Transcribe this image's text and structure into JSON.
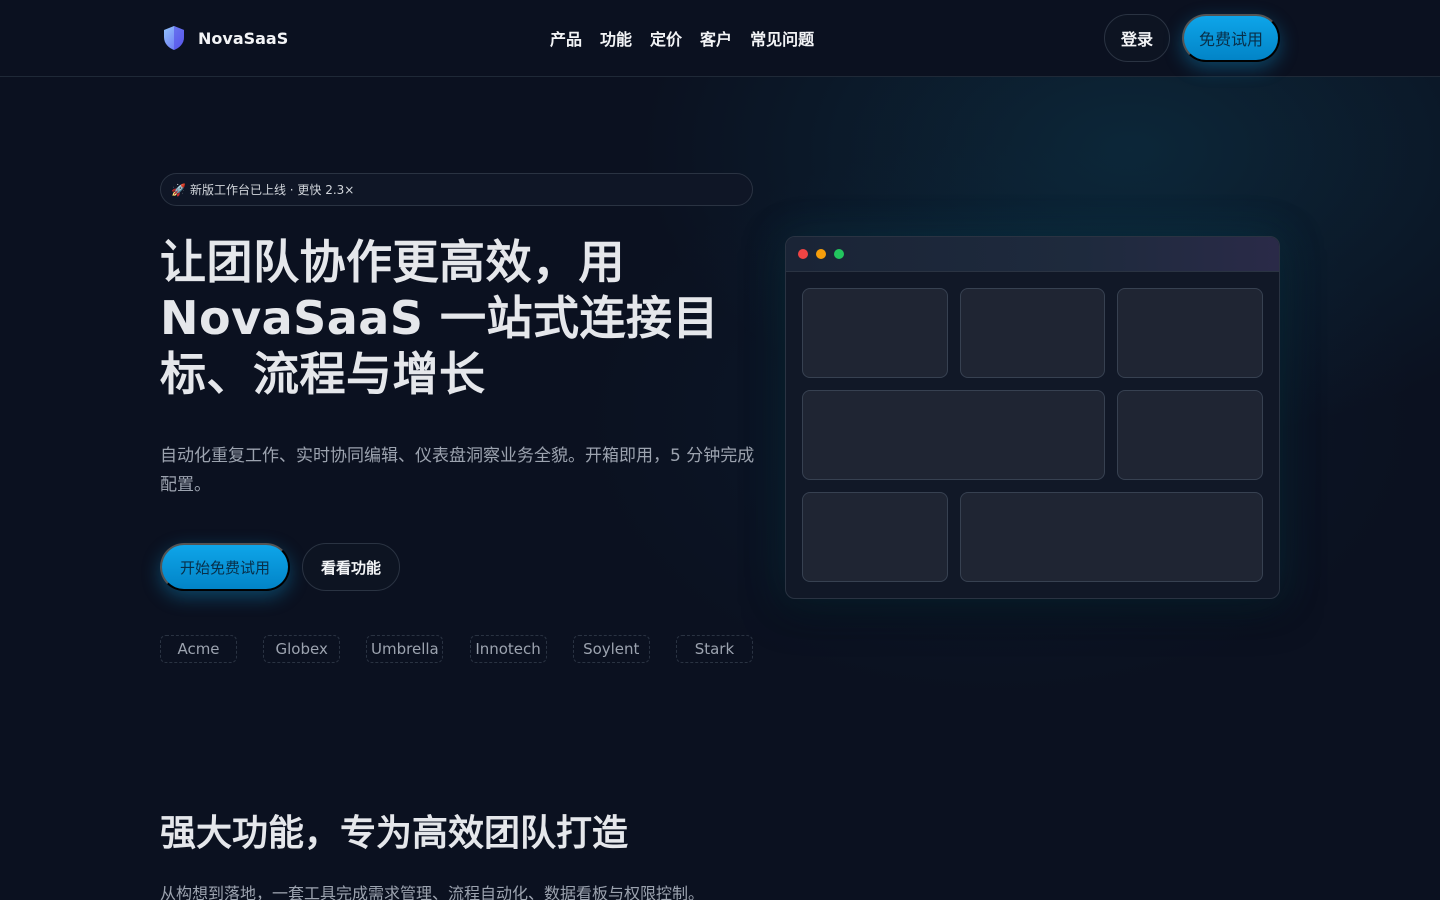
{
  "nav": {
    "brand": "NovaSaaS",
    "links": [
      "产品",
      "功能",
      "定价",
      "客户",
      "常见问题"
    ],
    "login": "登录",
    "trial": "免费试用"
  },
  "hero": {
    "badge_icon": "rocket-icon",
    "badge_emoji": "🚀",
    "badge": "新版工作台已上线 · 更快 2.3×",
    "title": "让团队协作更高效，用 NovaSaaS 一站式连接目标、流程与增长",
    "subtitle": "自动化重复工作、实时协同编辑、仪表盘洞察业务全貌。开箱即用，5 分钟完成配置。",
    "cta_primary": "开始免费试用",
    "cta_secondary": "看看功能",
    "logos": [
      "Acme",
      "Globex",
      "Umbrella",
      "Innotech",
      "Soylent",
      "Stark"
    ]
  },
  "features": {
    "title": "强大功能，专为高效团队打造",
    "subtitle": "从构想到落地，一套工具完成需求管理、流程自动化、数据看板与权限控制。"
  },
  "colors": {
    "background": "#0b1120",
    "accent": "#0ea5e9",
    "window_dot_red": "#ef4444",
    "window_dot_yellow": "#f59e0b",
    "window_dot_green": "#22c55e"
  }
}
